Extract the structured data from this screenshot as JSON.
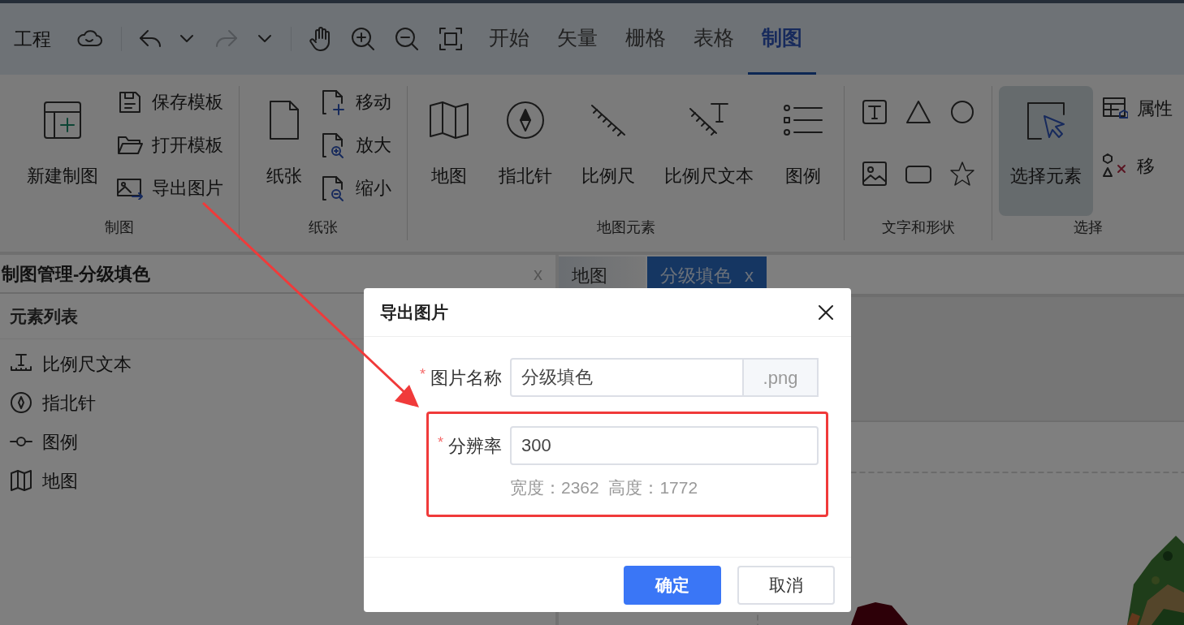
{
  "top_bar": {
    "project": "工程",
    "redo_disabled": true,
    "tabs": [
      {
        "label": "开始",
        "selected": false
      },
      {
        "label": "矢量",
        "selected": false
      },
      {
        "label": "栅格",
        "selected": false
      },
      {
        "label": "表格",
        "selected": false
      },
      {
        "label": "制图",
        "selected": true
      }
    ]
  },
  "ribbon": {
    "groups": [
      {
        "label": "制图",
        "kind": "mixed",
        "items": [
          {
            "label": "新建制图",
            "kind": "large",
            "selected": false
          },
          {
            "label": "保存模板",
            "kind": "small",
            "selected": false
          },
          {
            "label": "打开模板",
            "kind": "small",
            "selected": false
          },
          {
            "label": "导出图片",
            "kind": "small",
            "selected": false
          }
        ]
      },
      {
        "label": "纸张",
        "kind": "mixed",
        "items": [
          {
            "label": "纸张",
            "kind": "large",
            "selected": false
          },
          {
            "label": "移动",
            "kind": "small",
            "selected": false
          },
          {
            "label": "放大",
            "kind": "small",
            "selected": false
          },
          {
            "label": "缩小",
            "kind": "small",
            "selected": false
          }
        ]
      },
      {
        "label": "地图元素",
        "kind": "mixed",
        "items": [
          {
            "label": "地图",
            "kind": "large",
            "selected": false
          },
          {
            "label": "指北针",
            "kind": "large",
            "selected": false
          },
          {
            "label": "比例尺",
            "kind": "large",
            "selected": false
          },
          {
            "label": "比例尺文本",
            "kind": "large",
            "selected": false
          },
          {
            "label": "图例",
            "kind": "large",
            "selected": false
          }
        ]
      },
      {
        "label": "文字和形状",
        "kind": "shapes"
      },
      {
        "label": "选择",
        "kind": "mixed",
        "items": [
          {
            "label": "选择元素",
            "kind": "large",
            "selected": true
          },
          {
            "label": "属性",
            "kind": "small",
            "selected": false
          },
          {
            "label": "移",
            "kind": "small",
            "selected": false
          }
        ]
      }
    ]
  },
  "left_panel": {
    "title": "制图管理-分级填色",
    "close": "x",
    "section": "元素列表",
    "items": [
      {
        "label": "比例尺文本"
      },
      {
        "label": "指北针"
      },
      {
        "label": "图例"
      },
      {
        "label": "地图"
      }
    ]
  },
  "doc_tabs": [
    {
      "label": "地图",
      "selected": false
    },
    {
      "label": "分级填色",
      "selected": true,
      "close": "x"
    }
  ],
  "dialog": {
    "title": "导出图片",
    "fields": [
      {
        "label": "图片名称",
        "required_mark": "*",
        "value": "分级填色",
        "suffix": ".png"
      },
      {
        "label": "分辨率",
        "required_mark": "*",
        "value": "300",
        "hint": "宽度：2362  高度：1772"
      }
    ],
    "buttons": [
      {
        "label": "确定",
        "kind": "primary"
      },
      {
        "label": "取消",
        "kind": "default"
      }
    ]
  }
}
